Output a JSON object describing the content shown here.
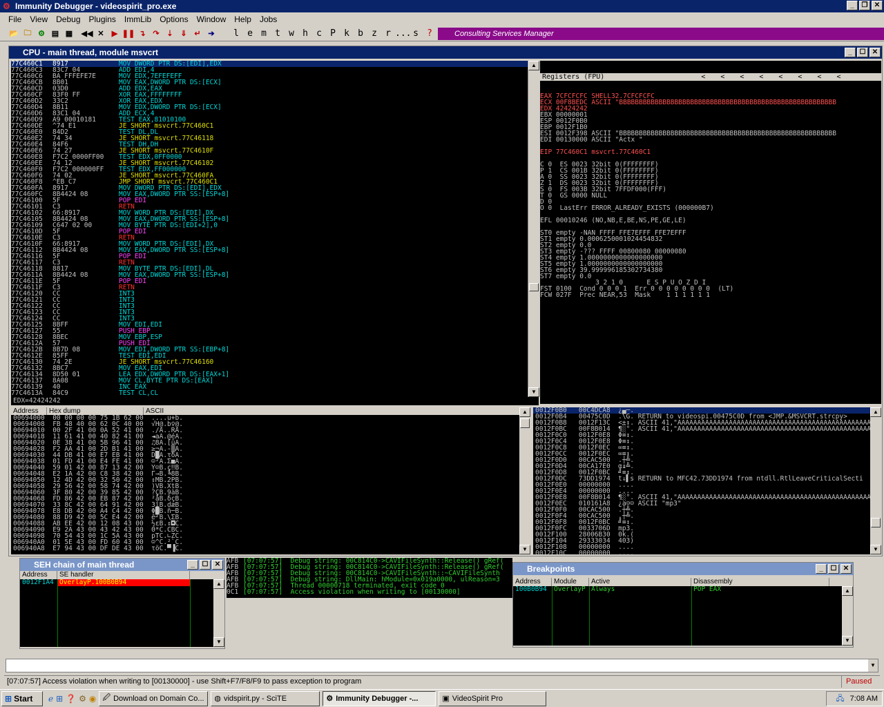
{
  "window": {
    "title": "Immunity Debugger - videospirit_pro.exe"
  },
  "menu": [
    "File",
    "View",
    "Debug",
    "Plugins",
    "ImmLib",
    "Options",
    "Window",
    "Help",
    "Jobs"
  ],
  "toolbar_letters": [
    "l",
    "e",
    "m",
    "t",
    "w",
    "h",
    "c",
    "P",
    "k",
    "b",
    "z",
    "r",
    "...",
    "s",
    "?"
  ],
  "consulting": "Consulting Services Manager",
  "cpu": {
    "title": "CPU - main thread, module msvcrt",
    "disasm": [
      [
        "77C460C1",
        "8917",
        "MOV DWORD PTR DS:[EDI],EDX"
      ],
      [
        "77C460C3",
        "83C7 04",
        "ADD EDI,4"
      ],
      [
        "77C460C6",
        "BA FFFEFE7E",
        "MOV EDX,7EFEFEFF"
      ],
      [
        "77C460CB",
        "8B01",
        "MOV EAX,DWORD PTR DS:[ECX]"
      ],
      [
        "77C460CD",
        "03D0",
        "ADD EDX,EAX"
      ],
      [
        "77C460CF",
        "83F0 FF",
        "XOR EAX,FFFFFFFF"
      ],
      [
        "77C460D2",
        "33C2",
        "XOR EAX,EDX"
      ],
      [
        "77C460D4",
        "8B11",
        "MOV EDX,DWORD PTR DS:[ECX]"
      ],
      [
        "77C460D6",
        "83C1 04",
        "ADD ECX,4"
      ],
      [
        "77C460D9",
        "A9 00010181",
        "TEST EAX,81010100"
      ],
      [
        "77C460DE",
        "^74 E1",
        "JE SHORT msvcrt.77C460C1"
      ],
      [
        "77C460E0",
        "84D2",
        "TEST DL,DL"
      ],
      [
        "77C460E2",
        "74 34",
        "JE SHORT msvcrt.77C46118"
      ],
      [
        "77C460E4",
        "84F6",
        "TEST DH,DH"
      ],
      [
        "77C460E6",
        "74 27",
        "JE SHORT msvcrt.77C4610F"
      ],
      [
        "77C460E8",
        "F7C2 0000FF00",
        "TEST EDX,0FF0000"
      ],
      [
        "77C460EE",
        "74 12",
        "JE SHORT msvcrt.77C46102"
      ],
      [
        "77C460F0",
        "F7C2 000000FF",
        "TEST EDX,FF000000"
      ],
      [
        "77C460F6",
        "74 02",
        "JE SHORT msvcrt.77C460FA"
      ],
      [
        "77C460F8",
        "^EB C7",
        "JMP SHORT msvcrt.77C460C1"
      ],
      [
        "77C460FA",
        "8917",
        "MOV DWORD PTR DS:[EDI],EDX"
      ],
      [
        "77C460FC",
        "8B4424 08",
        "MOV EAX,DWORD PTR SS:[ESP+8]"
      ],
      [
        "77C46100",
        "5F",
        "POP EDI"
      ],
      [
        "77C46101",
        "C3",
        "RETN"
      ],
      [
        "77C46102",
        "66:8917",
        "MOV WORD PTR DS:[EDI],DX"
      ],
      [
        "77C46105",
        "8B4424 08",
        "MOV EAX,DWORD PTR SS:[ESP+8]"
      ],
      [
        "77C46109",
        "C647 02 00",
        "MOV BYTE PTR DS:[EDI+2],0"
      ],
      [
        "77C4610D",
        "5F",
        "POP EDI"
      ],
      [
        "77C4610E",
        "C3",
        "RETN"
      ],
      [
        "77C4610F",
        "66:8917",
        "MOV WORD PTR DS:[EDI],DX"
      ],
      [
        "77C46112",
        "8B4424 08",
        "MOV EAX,DWORD PTR SS:[ESP+8]"
      ],
      [
        "77C46116",
        "5F",
        "POP EDI"
      ],
      [
        "77C46117",
        "C3",
        "RETN"
      ],
      [
        "77C46118",
        "8817",
        "MOV BYTE PTR DS:[EDI],DL"
      ],
      [
        "77C4611A",
        "8B4424 08",
        "MOV EAX,DWORD PTR SS:[ESP+8]"
      ],
      [
        "77C4611E",
        "5F",
        "POP EDI"
      ],
      [
        "77C4611F",
        "C3",
        "RETN"
      ],
      [
        "77C46120",
        "CC",
        "INT3"
      ],
      [
        "77C46121",
        "CC",
        "INT3"
      ],
      [
        "77C46122",
        "CC",
        "INT3"
      ],
      [
        "77C46123",
        "CC",
        "INT3"
      ],
      [
        "77C46124",
        "CC",
        "INT3"
      ],
      [
        "77C46125",
        "8BFF",
        "MOV EDI,EDI"
      ],
      [
        "77C46127",
        "55",
        "PUSH EBP"
      ],
      [
        "77C46128",
        "8BEC",
        "MOV EBP,ESP"
      ],
      [
        "77C4612A",
        "57",
        "PUSH EDI"
      ],
      [
        "77C4612B",
        "8B7D 08",
        "MOV EDI,DWORD PTR SS:[EBP+8]"
      ],
      [
        "77C4612E",
        "85FF",
        "TEST EDI,EDI"
      ],
      [
        "77C46130",
        "74 2E",
        "JE SHORT msvcrt.77C46160"
      ],
      [
        "77C46132",
        "8BC7",
        "MOV EAX,EDI"
      ],
      [
        "77C46134",
        "8D50 01",
        "LEA EDX,DWORD PTR DS:[EAX+1]"
      ],
      [
        "77C46137",
        "8A08",
        "MOV CL,BYTE PTR DS:[EAX]"
      ],
      [
        "77C46139",
        "40",
        "INC EAX"
      ],
      [
        "77C4613A",
        "84C9",
        "TEST CL,CL"
      ]
    ],
    "info_line": "EDX=42424242",
    "registers_title": "Registers (FPU)",
    "registers": [
      "EAX 7CFCFCFC SHELL32.7CFCFCFC",
      "ECX 00F8BEDC ASCII \"BBBBBBBBBBBBBBBBBBBBBBBBBBBBBBBBBBBBBBBBBBBBBBBBBBBBBBB",
      "EDX 42424242",
      "EBX 00000001",
      "ESP 0012F0B0",
      "EBP 0012F1B0",
      "ESI 0012F398 ASCII \"BBBBBBBBBBBBBBBBBBBBBBBBBBBBBBBBBBBBBBBBBBBBBBBBBBBBBBB",
      "EDI 00130000 ASCII \"Actx \"",
      "",
      "EIP 77C460C1 msvcrt.77C460C1",
      "",
      "C 0  ES 0023 32bit 0(FFFFFFFF)",
      "P 1  CS 001B 32bit 0(FFFFFFFF)",
      "A 0  SS 0023 32bit 0(FFFFFFFF)",
      "Z 1  DS 0023 32bit 0(FFFFFFFF)",
      "S 0  FS 003B 32bit 7FFDF000(FFF)",
      "T 0  GS 0000 NULL",
      "D 0",
      "O 0  LastErr ERROR_ALREADY_EXISTS (000000B7)",
      "",
      "EFL 00010246 (NO,NB,E,BE,NS,PE,GE,LE)",
      "",
      "ST0 empty -NAN FFFF FFE7EFFF FFE7EFFF",
      "ST1 empty 0.0006250001024454832",
      "ST2 empty 0.0",
      "ST3 empty -??? FFFF 00800080 00000080",
      "ST4 empty 1.0000000000000000000",
      "ST5 empty 1.0000000000000000000",
      "ST6 empty 39.999996185302734380",
      "ST7 empty 0.0",
      "              3 2 1 0      E S P U O Z D I",
      "FST 0100  Cond 0 0 0 1  Err 0 0 0 0 0 0 0 0  (LT)",
      "FCW 027F  Prec NEAR,53  Mask    1 1 1 1 1 1"
    ],
    "dump_headers": [
      "Address",
      "Hex dump",
      "ASCII"
    ],
    "dump": [
      "00694000  00 00 00 00 75 1B 62 00  ....u+b.",
      "00694008  FB 48 40 00 62 0C 40 00  √H@.b♀@.",
      "00694010  00 2F 41 00 0A 52 41 00  ./A..RA.",
      "00694018  11 61 41 00 40 82 41 00  ◄aA.@éA.",
      "00694020  0E 38 41 00 5B 96 41 00  ♫8A.[ûA.",
      "00694028  F2 AA 41 00 2D B1 41 00  ≥¬A.-▒A.",
      "00694030  44 DB 41 00 E7 EB 41 00  D█A.τδA.",
      "00694038  01 FD 41 00 E4 FE 41 00  ☺²A.Σ■A.",
      "00694040  59 01 42 00 87 13 42 00  Y☺B.ç‼B.",
      "00694048  E2 1A 42 00 C8 38 42 00  Γ→B.╚8B.",
      "00694050  12 4D 42 00 32 50 42 00  ↕MB.2PB.",
      "00694058  29 56 42 00 58 74 42 00  )VB.XtB.",
      "00694060  3F 80 42 00 39 85 42 00  ?ÇB.9àB.",
      "00694068  FD 86 42 00 EB 87 42 00  ²åB.δçB.",
      "00694070  33 8C 42 00 64 91 42 00  3îB.dæB.",
      "00694078  E8 DB 42 00 A4 C4 42 00  Φ█B.ñ─B.",
      "00694080  88 D9 42 00 5C E4 42 00  ê┘B.\\ΣB.",
      "00694088  AB EE 42 00 12 08 43 00  ½εB.↕◘C.",
      "00694090  E9 2A 43 00 43 42 43 00  Θ*C.CBC.",
      "00694098  70 54 43 00 1C 5A 43 00  pTC.∟ZC.",
      "006940A0  01 5E 43 00 FD 60 43 00  ☺^C.²`C.",
      "006940A8  E7 94 43 00 DF DE 43 00  τöC.▀▐C."
    ],
    "stack": [
      "0012F0B0   00C4DCA8  ¿▄─.",
      "0012F0B4   00475C0D  .\\G. RETURN to videospi.00475C0D from <JMP.&MSVCRT.strcpy>",
      "0012F0B8   0012F13C  <±↕. ASCII 41,\"AAAAAAAAAAAAAAAAAAAAAAAAAAAAAAAAAAAAAAAAAAAAAAAAAAA",
      "0012F0BC   00F8B014  ¶░°. ASCII 41,\"AAAAAAAAAAAAAAAAAAAAAAAAAAAAAAAAAAAAAAAAAAAAAAAAAAA",
      "0012F0C0   0012F0E8  Φ≡↕.",
      "0012F0C4   0012F0E8  Φ≡↕.",
      "0012F0C8   0012F0EC  ∞≡↕.",
      "0012F0CC   0012F0EC  ∞≡↕.",
      "0012F0D0   00CAC500  .┼╩.",
      "0012F0D4   00CA17E0  α↨╩.",
      "0012F0D8   0012F0BC  ╝≡↕.",
      "0012F0DC   73DD1974  t↓▌s RETURN to MFC42.73DD1974 from ntdll.RtlLeaveCriticalSecti",
      "0012F0E0   00000000  ....",
      "0012F0E4   00000000  ....",
      "0012F0E8   00F8B014  ¶░°. ASCII 41,\"AAAAAAAAAAAAAAAAAAAAAAAAAAAAAAAAAAAAAAAAAAAAAAAAAAA",
      "0012F0EC   010161A8  ¿a☺☺ ASCII \"mp3\"",
      "0012F0F0   00CAC500  .┼╩.",
      "0012F0F4   00CAC500  .┼╩.",
      "0012F0F8   0012F0BC  ╝≡↕.",
      "0012F0FC   0033706D  mp3.",
      "0012F100   28006B30  0k.(",
      "0012F104   29333034  403)",
      "0012F108   00000000  ....",
      "0012F10C   00000000  ...."
    ]
  },
  "seh": {
    "title": "SEH chain of main thread",
    "headers": [
      "Address",
      "SE handler"
    ],
    "rows": [
      [
        "0012F1A4",
        "OverlayP.100B0B94"
      ]
    ]
  },
  "log": [
    [
      "AFB",
      "[07:07:57]  Debug string: 00C814C0->CAVIFileSynth::Release() gRef("
    ],
    [
      "AFB",
      "[07:07:57]  Debug string: 00C814C0->CAVIFileSynth::Release() gRef("
    ],
    [
      "AFB",
      "[07:07:57]  Debug string: 00C814C0->CAVIFileSynth::~CAVIFileSynth"
    ],
    [
      "AFB",
      "[07:07:57]  Debug string: DllMain: hModule=0x019a0000, ulReason=3"
    ],
    [
      "AFB",
      "[07:07:57]  Thread 00000718 terminated, exit code 0"
    ],
    [
      "0C1",
      "[07:07:57]  Access violation when writing to [00130000]"
    ]
  ],
  "breakpoints": {
    "title": "Breakpoints",
    "headers": [
      "Address",
      "Module",
      "Active",
      "Disassembly"
    ],
    "rows": [
      [
        "100B0B94",
        "OverlayP",
        "Always",
        "POP EAX"
      ]
    ]
  },
  "status": {
    "message": "[07:07:57] Access violation when writing to [00130000] - use Shift+F7/F8/F9 to pass exception to program",
    "state": "Paused"
  },
  "taskbar": {
    "start": "Start",
    "tasks": [
      "Download on Domain Co...",
      "vidspirit.py - SciTE",
      "Immunity Debugger -...",
      "VideoSpirit Pro"
    ],
    "active_index": 2,
    "clock": "7:08 AM"
  }
}
